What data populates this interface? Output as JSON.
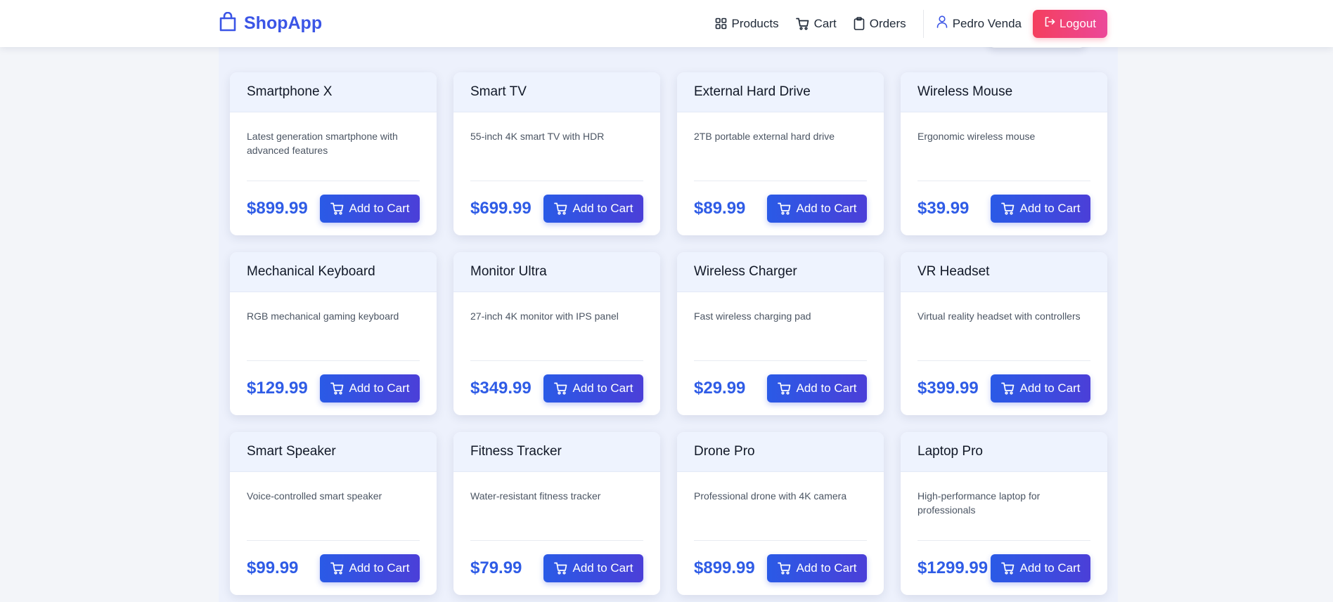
{
  "app": {
    "brand_name": "ShopApp",
    "brand_icon": "shopping-bag-icon",
    "accent_color": "#3b55e6"
  },
  "nav": {
    "items": [
      {
        "label": "Products",
        "icon": "grid-icon"
      },
      {
        "label": "Cart",
        "icon": "cart-icon"
      },
      {
        "label": "Orders",
        "icon": "clipboard-icon"
      }
    ],
    "user_name": "Pedro Venda",
    "user_icon": "user-icon",
    "logout_label": "Logout",
    "logout_icon": "logout-icon",
    "logout_color": "#f43f5e"
  },
  "products": [
    {
      "name": "Smartphone X",
      "description": "Latest generation smartphone with advanced features",
      "price": "$899.99",
      "button": "Add to Cart"
    },
    {
      "name": "Smart TV",
      "description": "55-inch 4K smart TV with HDR",
      "price": "$699.99",
      "button": "Add to Cart"
    },
    {
      "name": "External Hard Drive",
      "description": "2TB portable external hard drive",
      "price": "$89.99",
      "button": "Add to Cart"
    },
    {
      "name": "Wireless Mouse",
      "description": "Ergonomic wireless mouse",
      "price": "$39.99",
      "button": "Add to Cart"
    },
    {
      "name": "Mechanical Keyboard",
      "description": "RGB mechanical gaming keyboard",
      "price": "$129.99",
      "button": "Add to Cart"
    },
    {
      "name": "Monitor Ultra",
      "description": "27-inch 4K monitor with IPS panel",
      "price": "$349.99",
      "button": "Add to Cart"
    },
    {
      "name": "Wireless Charger",
      "description": "Fast wireless charging pad",
      "price": "$29.99",
      "button": "Add to Cart"
    },
    {
      "name": "VR Headset",
      "description": "Virtual reality headset with controllers",
      "price": "$399.99",
      "button": "Add to Cart"
    },
    {
      "name": "Smart Speaker",
      "description": "Voice-controlled smart speaker",
      "price": "$99.99",
      "button": "Add to Cart"
    },
    {
      "name": "Fitness Tracker",
      "description": "Water-resistant fitness tracker",
      "price": "$79.99",
      "button": "Add to Cart"
    },
    {
      "name": "Drone Pro",
      "description": "Professional drone with 4K camera",
      "price": "$899.99",
      "button": "Add to Cart"
    },
    {
      "name": "Laptop Pro",
      "description": "High-performance laptop for professionals",
      "price": "$1299.99",
      "button": "Add to Cart"
    }
  ]
}
